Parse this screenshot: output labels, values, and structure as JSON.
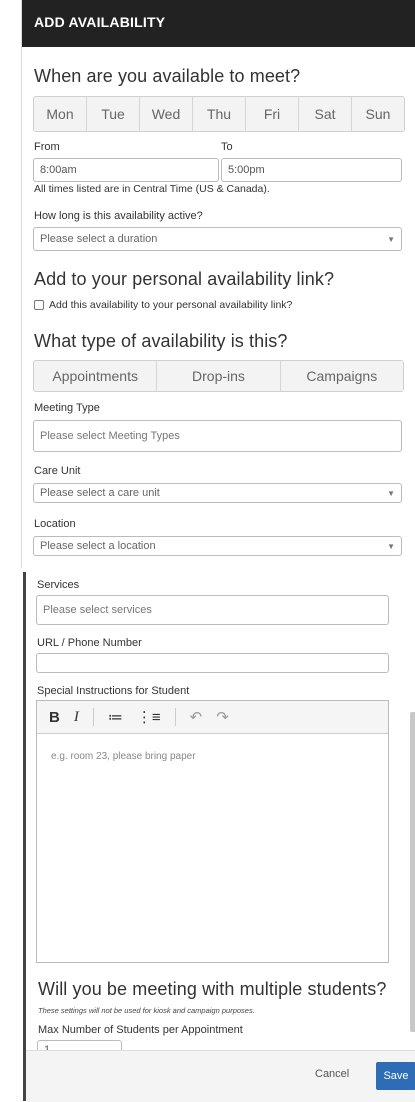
{
  "header": {
    "title": "ADD AVAILABILITY"
  },
  "when": {
    "heading": "When are you available to meet?",
    "days": [
      "Mon",
      "Tue",
      "Wed",
      "Thu",
      "Fri",
      "Sat",
      "Sun"
    ],
    "from_label": "From",
    "from_value": "8:00am",
    "to_label": "To",
    "to_value": "5:00pm",
    "timezone_note": "All times listed are in Central Time (US & Canada)."
  },
  "duration": {
    "label": "How long is this availability active?",
    "placeholder": "Please select a duration"
  },
  "personal_link": {
    "heading": "Add to your personal availability link?",
    "checkbox_label": "Add this availability to your personal availability link?"
  },
  "type": {
    "heading": "What type of availability is this?",
    "options": [
      "Appointments",
      "Drop-ins",
      "Campaigns"
    ]
  },
  "meeting_type": {
    "label": "Meeting Type",
    "placeholder": "Please select Meeting Types"
  },
  "care_unit": {
    "label": "Care Unit",
    "placeholder": "Please select a care unit"
  },
  "location": {
    "label": "Location",
    "placeholder": "Please select a location"
  },
  "services": {
    "label": "Services",
    "placeholder": "Please select services"
  },
  "url_phone": {
    "label": "URL / Phone Number",
    "value": ""
  },
  "instructions": {
    "label": "Special Instructions for Student",
    "placeholder": "e.g. room 23, please bring paper",
    "toolbar": {
      "bold": "B",
      "italic": "I",
      "bullets": "≔",
      "numbers": "⋮≡",
      "undo": "↶",
      "redo": "↷"
    }
  },
  "multiple": {
    "heading": "Will you be meeting with multiple students?",
    "note": "These settings will not be used for kiosk and campaign purposes.",
    "max_label": "Max Number of Students per Appointment",
    "max_value": "1"
  },
  "footer": {
    "cancel_label": "Cancel",
    "save_label": "Save"
  },
  "colors": {
    "header_bg": "#222222",
    "save_button": "#2e6db5"
  }
}
